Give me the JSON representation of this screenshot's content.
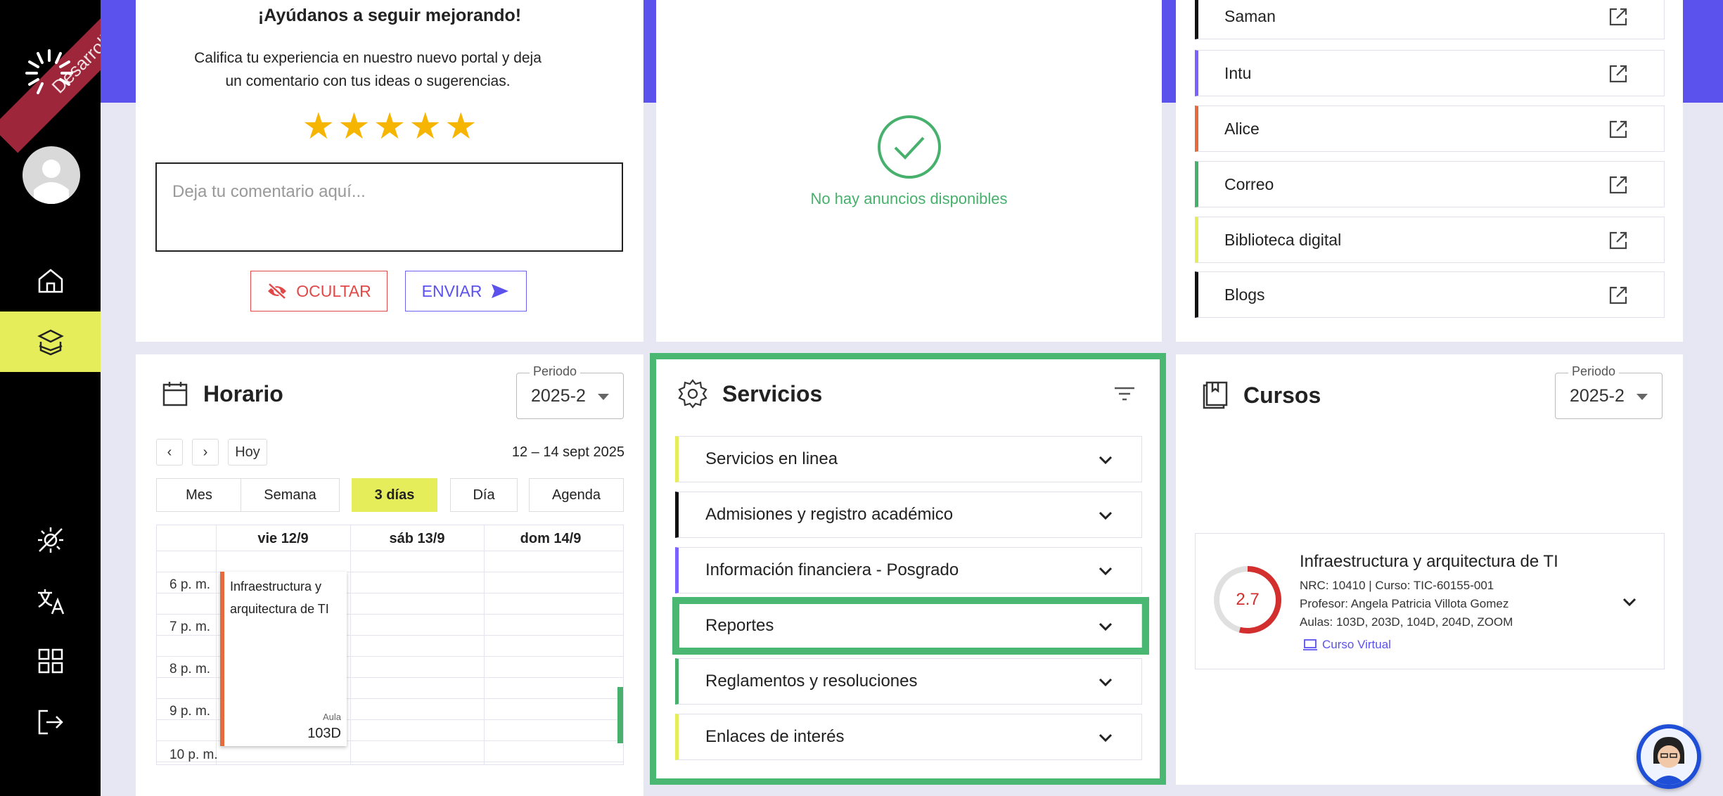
{
  "sidebar": {
    "ribbon_label": "Desarrollo",
    "items": [
      {
        "icon": "home-icon"
      },
      {
        "icon": "courses-icon",
        "active": true
      },
      {
        "icon": "theme-icon"
      },
      {
        "icon": "translate-icon"
      },
      {
        "icon": "apps-icon"
      },
      {
        "icon": "logout-icon"
      }
    ]
  },
  "feedback": {
    "title": "¡Ayúdanos a seguir mejorando!",
    "description": "Califica tu experiencia en nuestro nuevo portal y deja un comentario con tus ideas o sugerencias.",
    "stars": [
      "★",
      "★",
      "★",
      "★",
      "★"
    ],
    "rating_max": 5,
    "comment_value": "",
    "comment_placeholder": "Deja tu comentario aquí...",
    "hide_label": "OCULTAR",
    "send_label": "ENVIAR"
  },
  "announcements": {
    "empty_text": "No hay anuncios disponibles"
  },
  "links": [
    {
      "label": "Saman",
      "color": "#111111"
    },
    {
      "label": "Intu",
      "color": "#7b61ff"
    },
    {
      "label": "Alice",
      "color": "#e56a3c"
    },
    {
      "label": "Correo",
      "color": "#46b06c"
    },
    {
      "label": "Biblioteca digital",
      "color": "#e5ed5a"
    },
    {
      "label": "Blogs",
      "color": "#111111"
    }
  ],
  "schedule": {
    "title": "Horario",
    "period_label": "Periodo",
    "period_value": "2025-2",
    "prev": "‹",
    "next": "›",
    "today": "Hoy",
    "range": "12 – 14 sept 2025",
    "views": [
      "Mes",
      "Semana",
      "3 días",
      "Día",
      "Agenda"
    ],
    "active_view": "3 días",
    "days": [
      "vie 12/9",
      "sáb 13/9",
      "dom 14/9"
    ],
    "hours": [
      "6 p. m.",
      "7 p. m.",
      "8 p. m.",
      "9 p. m.",
      "10 p. m."
    ],
    "event": {
      "title": "Infraestructura y arquitectura de TI",
      "room_label": "Aula",
      "room": "103D"
    }
  },
  "services": {
    "title": "Servicios",
    "items": [
      {
        "label": "Servicios en linea",
        "color": "#e5ed5a"
      },
      {
        "label": "Admisiones y registro académico",
        "color": "#111111"
      },
      {
        "label": "Información financiera - Posgrado",
        "color": "#7b61ff"
      },
      {
        "label": "Reportes",
        "color": "#46b06c"
      },
      {
        "label": "Reglamentos y resoluciones",
        "color": "#46b06c"
      },
      {
        "label": "Enlaces de interés",
        "color": "#e5ed5a"
      }
    ]
  },
  "courses": {
    "title": "Cursos",
    "period_label": "Periodo",
    "period_value": "2025-2",
    "course": {
      "name": "Infraestructura y arquitectura de TI",
      "grade": "2.7",
      "grade_max": 5,
      "nrc_line": "NRC: 10410 | Curso: TIC-60155-001",
      "professor_line": "Profesor: Angela Patricia Villota Gomez",
      "rooms_line": "Aulas: 103D, 203D, 104D, 204D, ZOOM",
      "virtual_label": "Curso Virtual"
    }
  },
  "colors": {
    "accent": "#5b52ee",
    "highlight": "#e5ed5a",
    "success": "#46b06c",
    "danger": "#e14848"
  }
}
